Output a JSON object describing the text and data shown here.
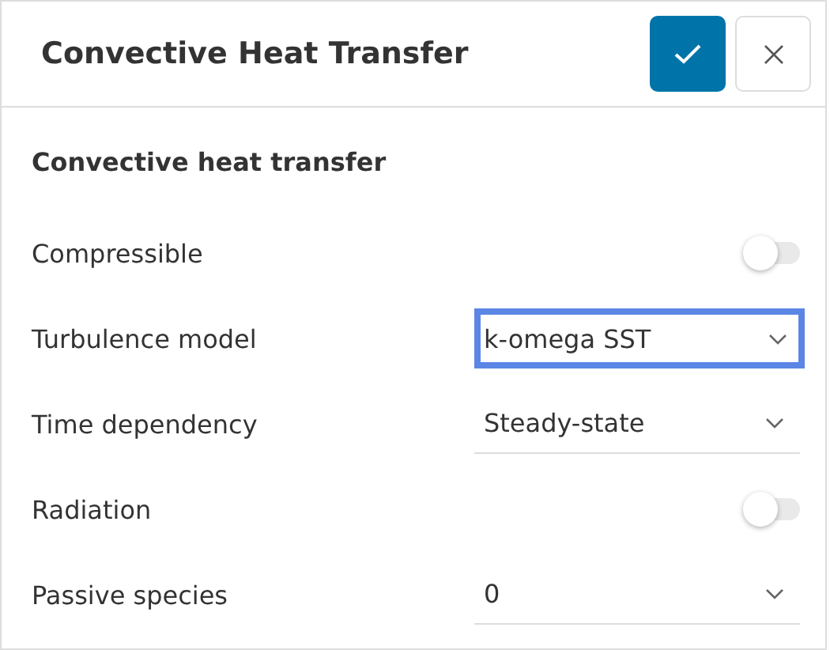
{
  "dialog": {
    "title": "Convective Heat Transfer"
  },
  "section": {
    "title": "Convective heat transfer"
  },
  "rows": [
    {
      "kind": "toggle",
      "label": "Compressible",
      "on": false
    },
    {
      "kind": "select",
      "label": "Turbulence model",
      "value": "k-omega SST",
      "focused": true
    },
    {
      "kind": "select",
      "label": "Time dependency",
      "value": "Steady-state",
      "focused": false
    },
    {
      "kind": "toggle",
      "label": "Radiation",
      "on": false
    },
    {
      "kind": "select",
      "label": "Passive species",
      "value": "0",
      "focused": false
    }
  ]
}
